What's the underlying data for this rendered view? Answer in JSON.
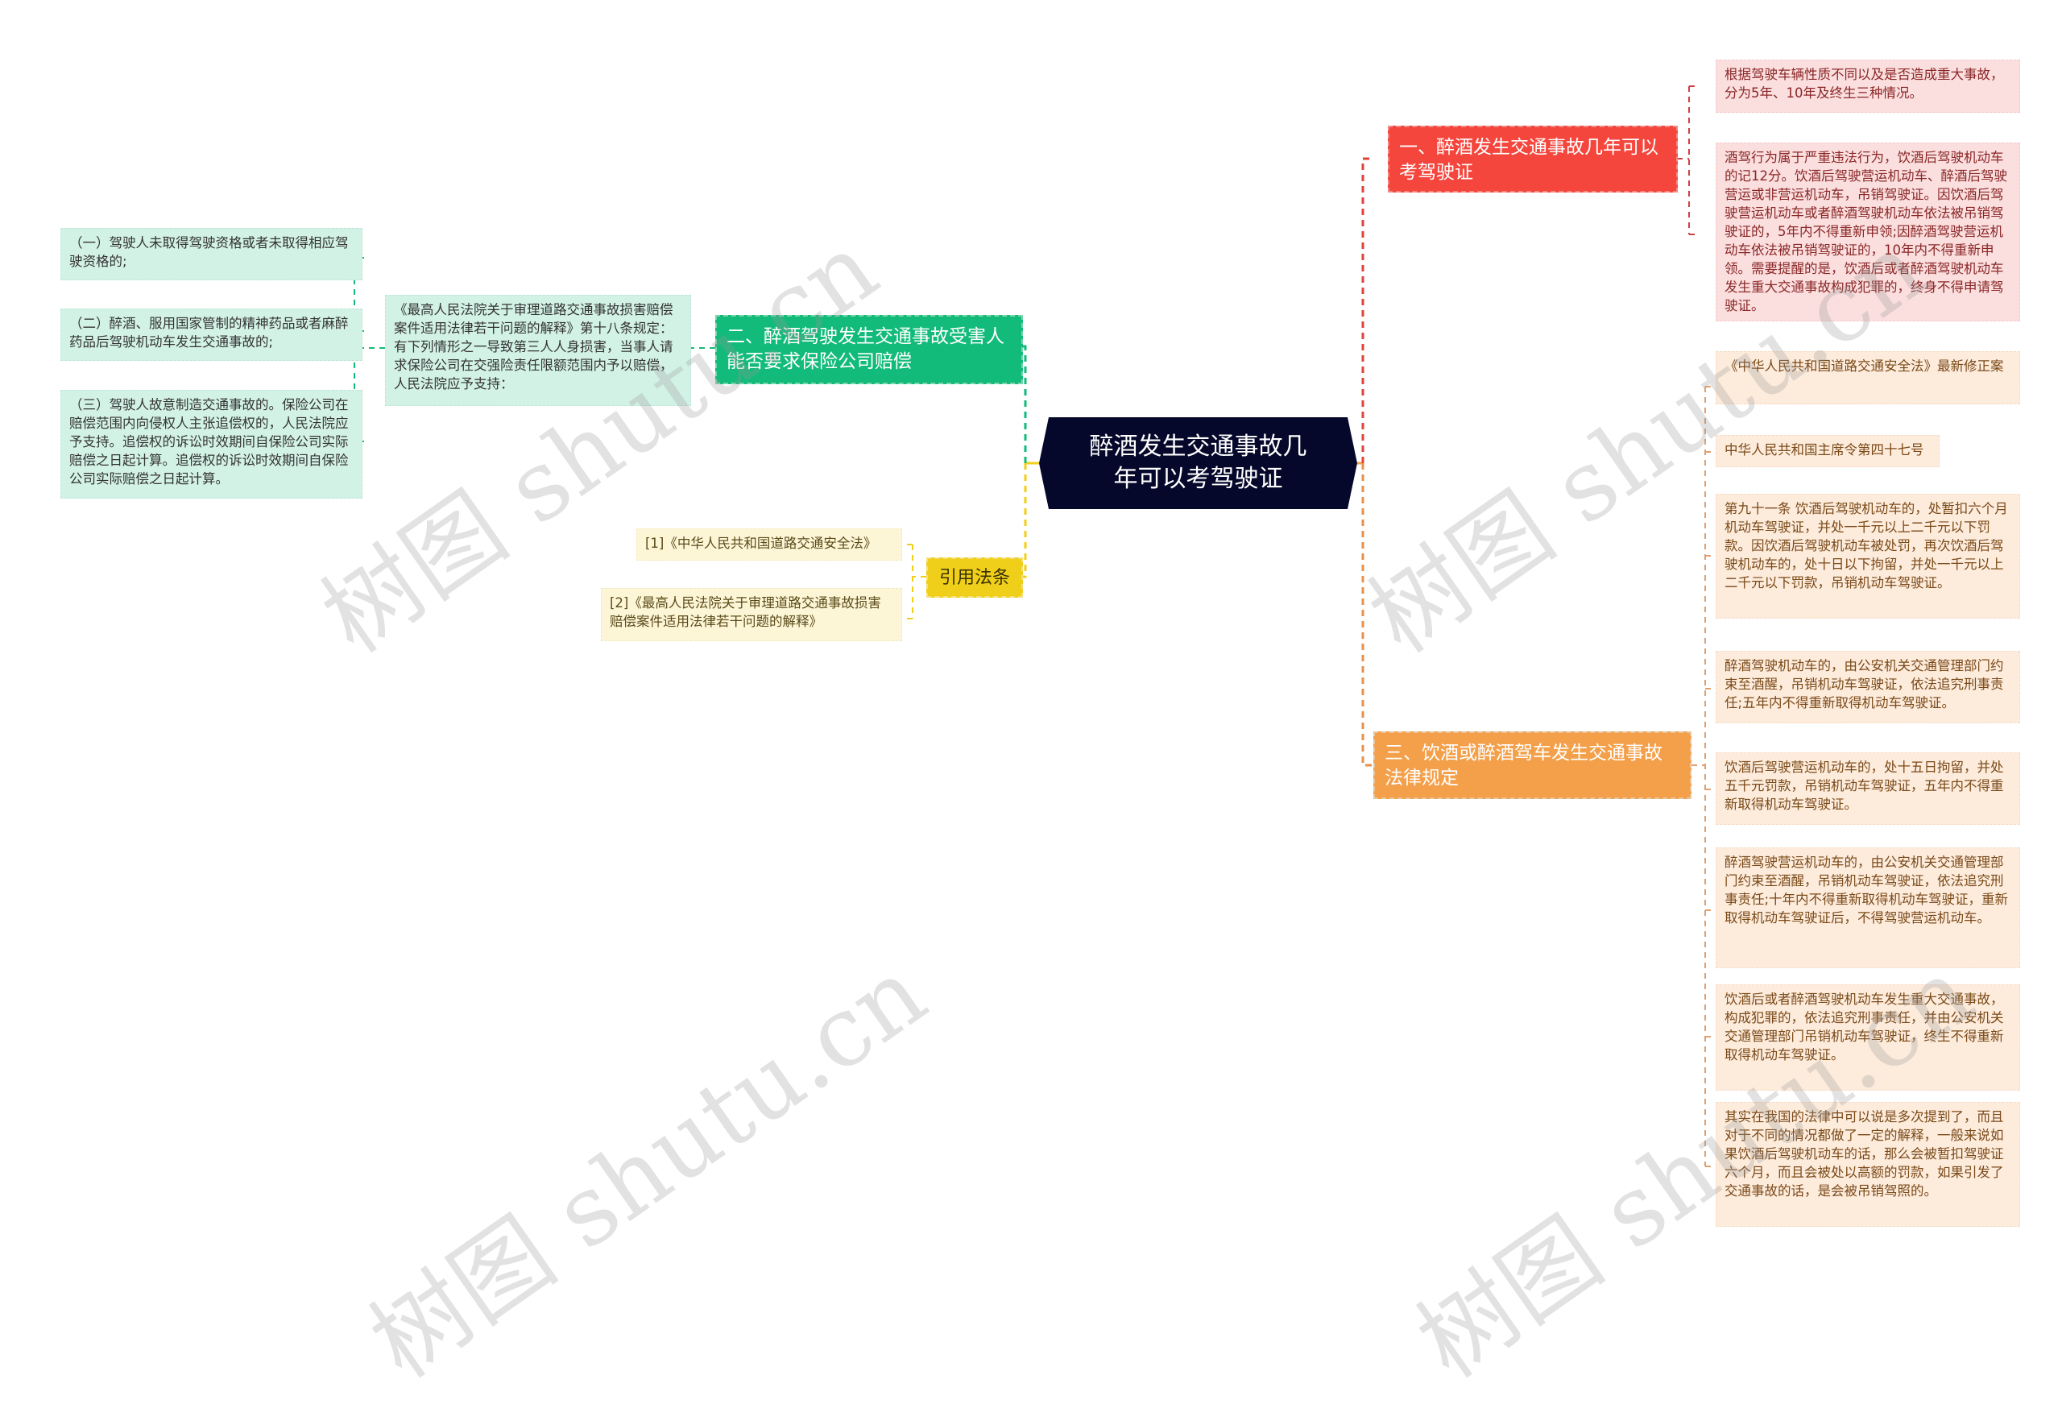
{
  "central": {
    "title": "醉酒发生交通事故几年可以考驾驶证"
  },
  "branches": {
    "one": {
      "label": "一、醉酒发生交通事故几年可以考驾驶证",
      "color": "#f4463d",
      "items": [
        "根据驾驶车辆性质不同以及是否造成重大事故，分为5年、10年及终生三种情况。",
        "酒驾行为属于严重违法行为，饮酒后驾驶机动车的记12分。饮酒后驾驶营运机动车、醉酒后驾驶营运或非营运机动车，吊销驾驶证。因饮酒后驾驶营运机动车或者醉酒驾驶机动车依法被吊销驾驶证的，5年内不得重新申领;因醉酒驾驶营运机动车依法被吊销驾驶证的，10年内不得重新申领。需要提醒的是，饮酒后或者醉酒驾驶机动车发生重大交通事故构成犯罪的，终身不得申请驾驶证。"
      ]
    },
    "two": {
      "label": "二、醉酒驾驶发生交通事故受害人能否要求保险公司赔偿",
      "color": "#12bb7a",
      "sub": {
        "text": "《最高人民法院关于审理道路交通事故损害赔偿案件适用法律若干问题的解释》第十八条规定：有下列情形之一导致第三人人身损害，当事人请求保险公司在交强险责任限额范围内予以赔偿，人民法院应予支持：",
        "items": [
          "（一）驾驶人未取得驾驶资格或者未取得相应驾驶资格的;",
          "（二）醉酒、服用国家管制的精神药品或者麻醉药品后驾驶机动车发生交通事故的;",
          "（三）驾驶人故意制造交通事故的。保险公司在赔偿范围内向侵权人主张追偿权的，人民法院应予支持。追偿权的诉讼时效期间自保险公司实际赔偿之日起计算。追偿权的诉讼时效期间自保险公司实际赔偿之日起计算。"
        ]
      }
    },
    "three": {
      "label": "三、饮酒或醉酒驾车发生交通事故法律规定",
      "color": "#f4a04a",
      "items": [
        "《中华人民共和国道路交通安全法》最新修正案",
        "中华人民共和国主席令第四十七号",
        "第九十一条 饮酒后驾驶机动车的，处暂扣六个月机动车驾驶证，并处一千元以上二千元以下罚款。因饮酒后驾驶机动车被处罚，再次饮酒后驾驶机动车的，处十日以下拘留，并处一千元以上二千元以下罚款，吊销机动车驾驶证。",
        "醉酒驾驶机动车的，由公安机关交通管理部门约束至酒醒，吊销机动车驾驶证，依法追究刑事责任;五年内不得重新取得机动车驾驶证。",
        "饮酒后驾驶营运机动车的，处十五日拘留，并处五千元罚款，吊销机动车驾驶证，五年内不得重新取得机动车驾驶证。",
        "醉酒驾驶营运机动车的，由公安机关交通管理部门约束至酒醒，吊销机动车驾驶证，依法追究刑事责任;十年内不得重新取得机动车驾驶证，重新取得机动车驾驶证后，不得驾驶营运机动车。",
        "饮酒后或者醉酒驾驶机动车发生重大交通事故，构成犯罪的，依法追究刑事责任，并由公安机关交通管理部门吊销机动车驾驶证，终生不得重新取得机动车驾驶证。",
        "其实在我国的法律中可以说是多次提到了，而且对于不同的情况都做了一定的解释，一般来说如果饮酒后驾驶机动车的话，那么会被暂扣驾驶证六个月，而且会被处以高额的罚款，如果引发了交通事故的话，是会被吊销驾照的。"
      ]
    },
    "refs": {
      "label": "引用法条",
      "color": "#f0cf1a",
      "items": [
        "[1]《中华人民共和国道路交通安全法》",
        "[2]《最高人民法院关于审理道路交通事故损害赔偿案件适用法律若干问题的解释》"
      ]
    }
  },
  "watermark": {
    "text": "树图 shutu.cn"
  }
}
